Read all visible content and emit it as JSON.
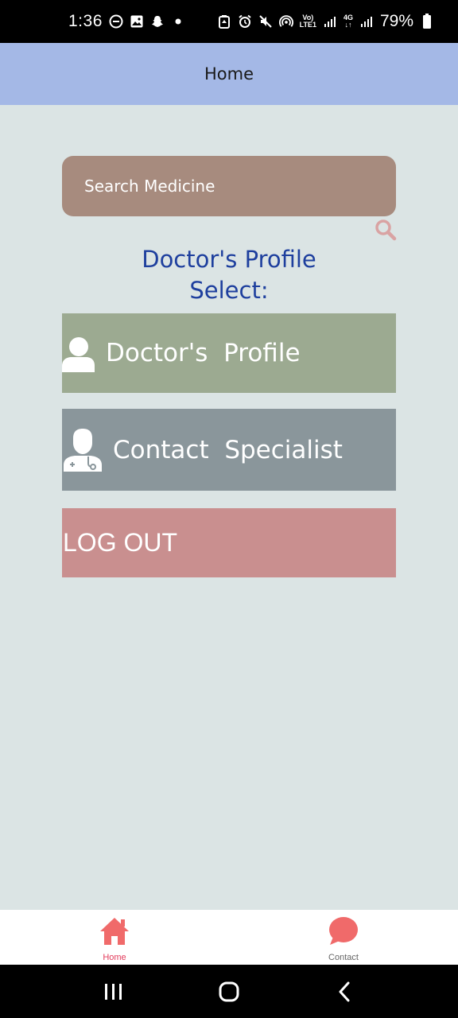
{
  "status_bar": {
    "time": "1:36",
    "net_top": "Vo)",
    "net_bottom": "LTE1",
    "net2_top": "4G",
    "battery": "79%"
  },
  "app_bar": {
    "title": "Home"
  },
  "search": {
    "placeholder": "Search Medicine",
    "icon": "search-icon"
  },
  "heading": {
    "line1": "Doctor's Profile",
    "line2": "Select:"
  },
  "buttons": {
    "doctor_profile": {
      "label": "Doctor's  Profile",
      "icon": "person-icon"
    },
    "contact_specialist": {
      "label": "Contact  Specialist",
      "icon": "doctor-icon"
    },
    "logout": {
      "label": "LOG OUT"
    }
  },
  "bottom_nav": [
    {
      "label": "Home",
      "icon": "home-icon",
      "active": true
    },
    {
      "label": "Contact",
      "icon": "chat-bubble-icon",
      "active": false
    }
  ],
  "colors": {
    "app_bar": "#a4b8e6",
    "background": "#dbe4e4",
    "search": "#a78b7e",
    "heading": "#1e3f9e",
    "profile_button": "#9caa91",
    "contact_button": "#8a969b",
    "logout_button": "#c98f8f",
    "nav_accent": "#f06a6a"
  }
}
